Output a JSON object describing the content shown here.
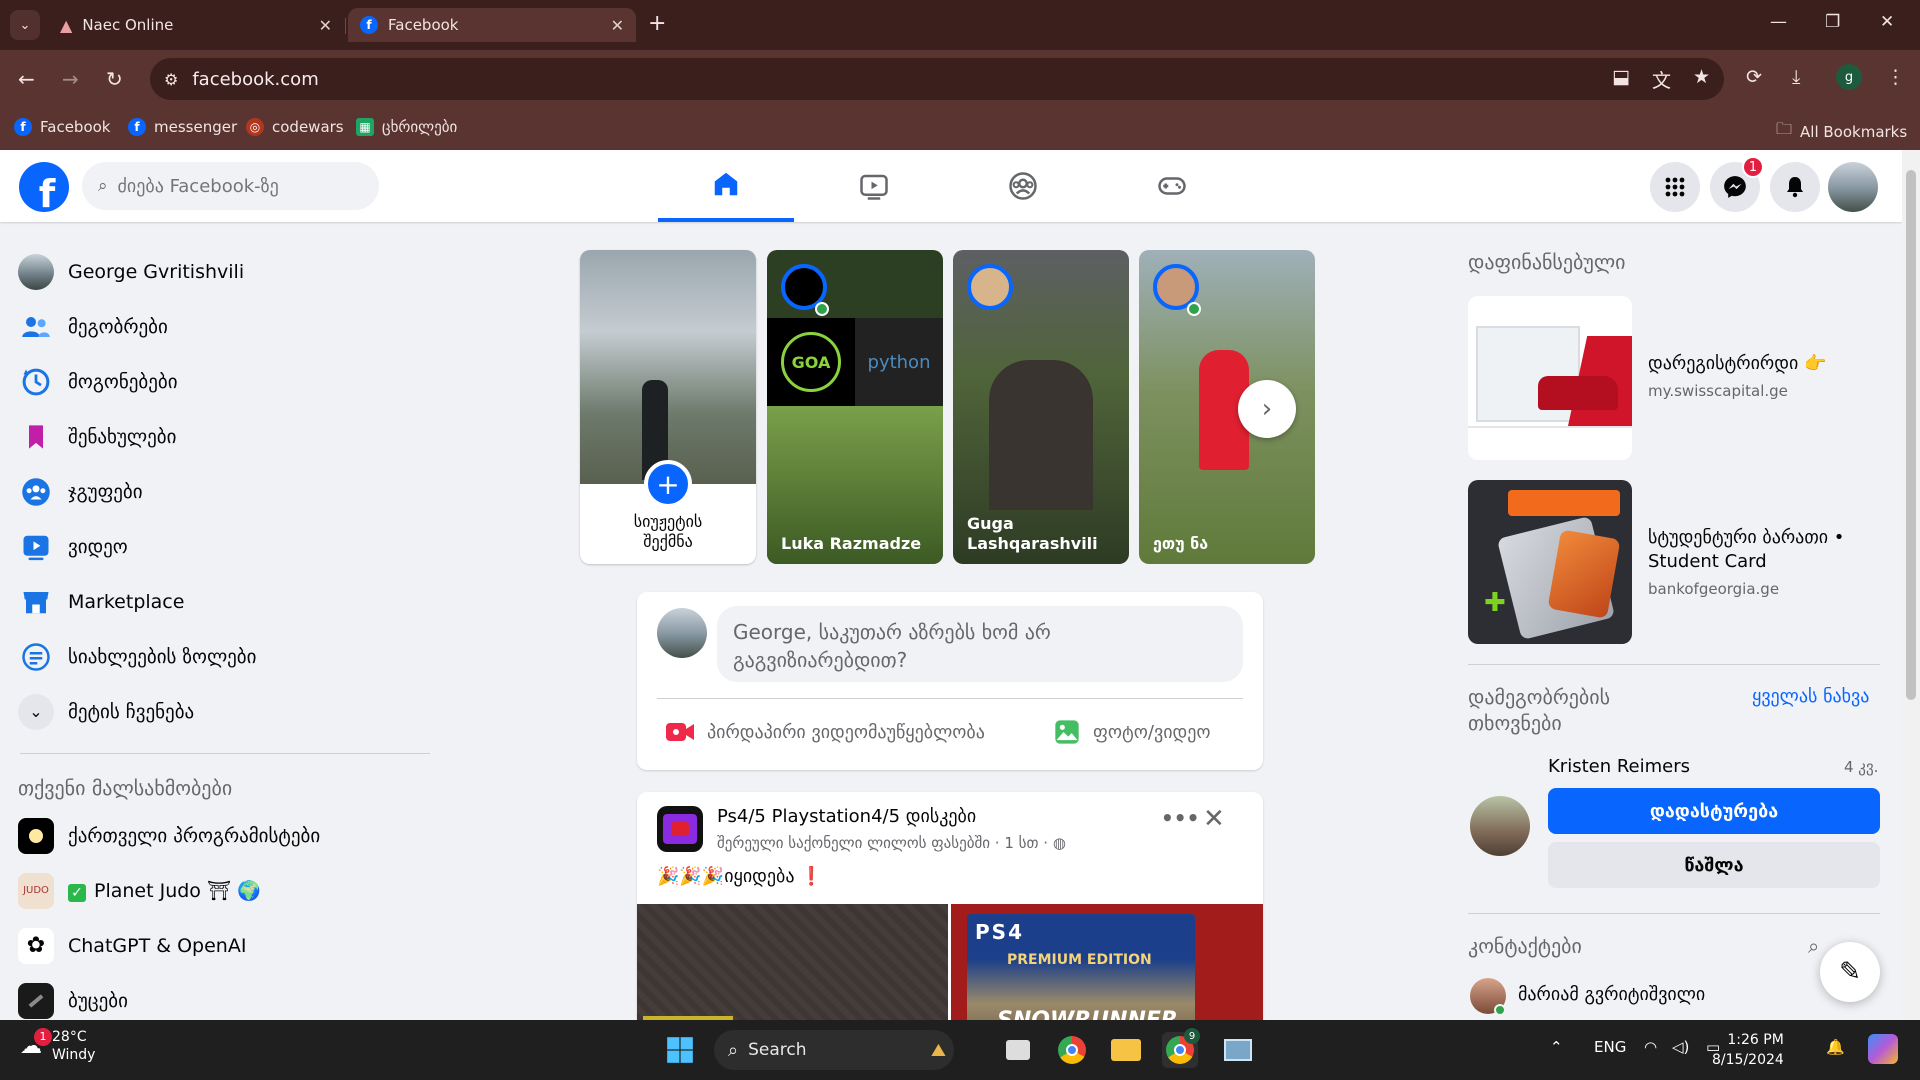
{
  "browser": {
    "tabs": [
      {
        "title": "Naec Online",
        "active": false
      },
      {
        "title": "Facebook",
        "active": true
      }
    ],
    "url": "facebook.com",
    "profile_initial": "g",
    "bookmarks": [
      {
        "label": "Facebook",
        "icon": "facebook-icon"
      },
      {
        "label": "messenger",
        "icon": "facebook-icon"
      },
      {
        "label": "codewars",
        "icon": "codewars-icon"
      },
      {
        "label": "ცხრილები",
        "icon": "sheets-icon"
      }
    ],
    "all_bookmarks": "All Bookmarks"
  },
  "header": {
    "search_placeholder": "ძიება Facebook-ზე",
    "messenger_badge": "1"
  },
  "left_nav": {
    "user_name": "George Gvritishvili",
    "items": [
      {
        "label": "მეგობრები",
        "icon": "friends-icon"
      },
      {
        "label": "მოგონებები",
        "icon": "memories-icon"
      },
      {
        "label": "შენახულები",
        "icon": "saved-icon"
      },
      {
        "label": "ჯგუფები",
        "icon": "groups-icon"
      },
      {
        "label": "ვიდეო",
        "icon": "video-icon"
      },
      {
        "label": "Marketplace",
        "icon": "marketplace-icon"
      },
      {
        "label": "სიახლეების ზოლები",
        "icon": "feeds-icon"
      },
      {
        "label": "მეტის ჩვენება",
        "icon": "chevron-down-icon"
      }
    ],
    "shortcuts_heading": "თქვენი მალსახმობები",
    "shortcuts": [
      {
        "label": "ქართველი პროგრამისტები"
      },
      {
        "label": "Planet Judo ⛩ 🌍"
      },
      {
        "label": "ChatGPT & OpenAI"
      },
      {
        "label": "ბუცები"
      }
    ]
  },
  "stories": {
    "create_label": "სიუჟეტის შექმნა",
    "items": [
      {
        "name": "Luka Razmadze"
      },
      {
        "name": "Guga Lashqarashvili"
      },
      {
        "name": "ეთუ ნა"
      }
    ]
  },
  "composer": {
    "placeholder": "George, საკუთარ აზრებს ხომ არ გაგვიზიარებდით?",
    "live_label": "პირდაპირი ვიდეომაუწყებლობა",
    "photo_label": "ფოტო/ვიდეო"
  },
  "post": {
    "group": "Ps4/5 Playstation4/5 დისკები",
    "author": "შერეული საქონელი ლილოს ფასებში",
    "time": "1 სთ",
    "text": "🎉🎉🎉იყიდება ❗",
    "image_text_1": "PS4",
    "image_text_2": "PREMIUM EDITION",
    "image_text_3": "SNOWRUNNER"
  },
  "right": {
    "sponsored_heading": "დაფინანსებული",
    "ads": [
      {
        "title": "დარეგისტრირდი 👉",
        "url": "my.swisscapital.ge"
      },
      {
        "title": "სტუდენტური ბარათი • Student Card",
        "url": "bankofgeorgia.ge"
      }
    ],
    "requests_heading": "დამეგობრების თხოვნები",
    "see_all": "ყველას ნახვა",
    "request": {
      "name": "Kristen Reimers",
      "time": "4 კვ.",
      "confirm": "დადასტურება",
      "delete": "წაშლა"
    },
    "contacts_heading": "კონტაქტები",
    "contacts": [
      {
        "name": "მარიამ გვრიტიშვილი"
      }
    ]
  },
  "taskbar": {
    "temp": "28°C",
    "weather": "Windy",
    "weather_badge": "1",
    "search_label": "Search",
    "lang": "ENG",
    "time": "1:26 PM",
    "date": "8/15/2024",
    "chrome_badge": "9"
  },
  "colors": {
    "fb_blue": "#0866ff",
    "chrome_bg": "#3b1f1d",
    "chrome_toolbar": "#5a3430"
  }
}
